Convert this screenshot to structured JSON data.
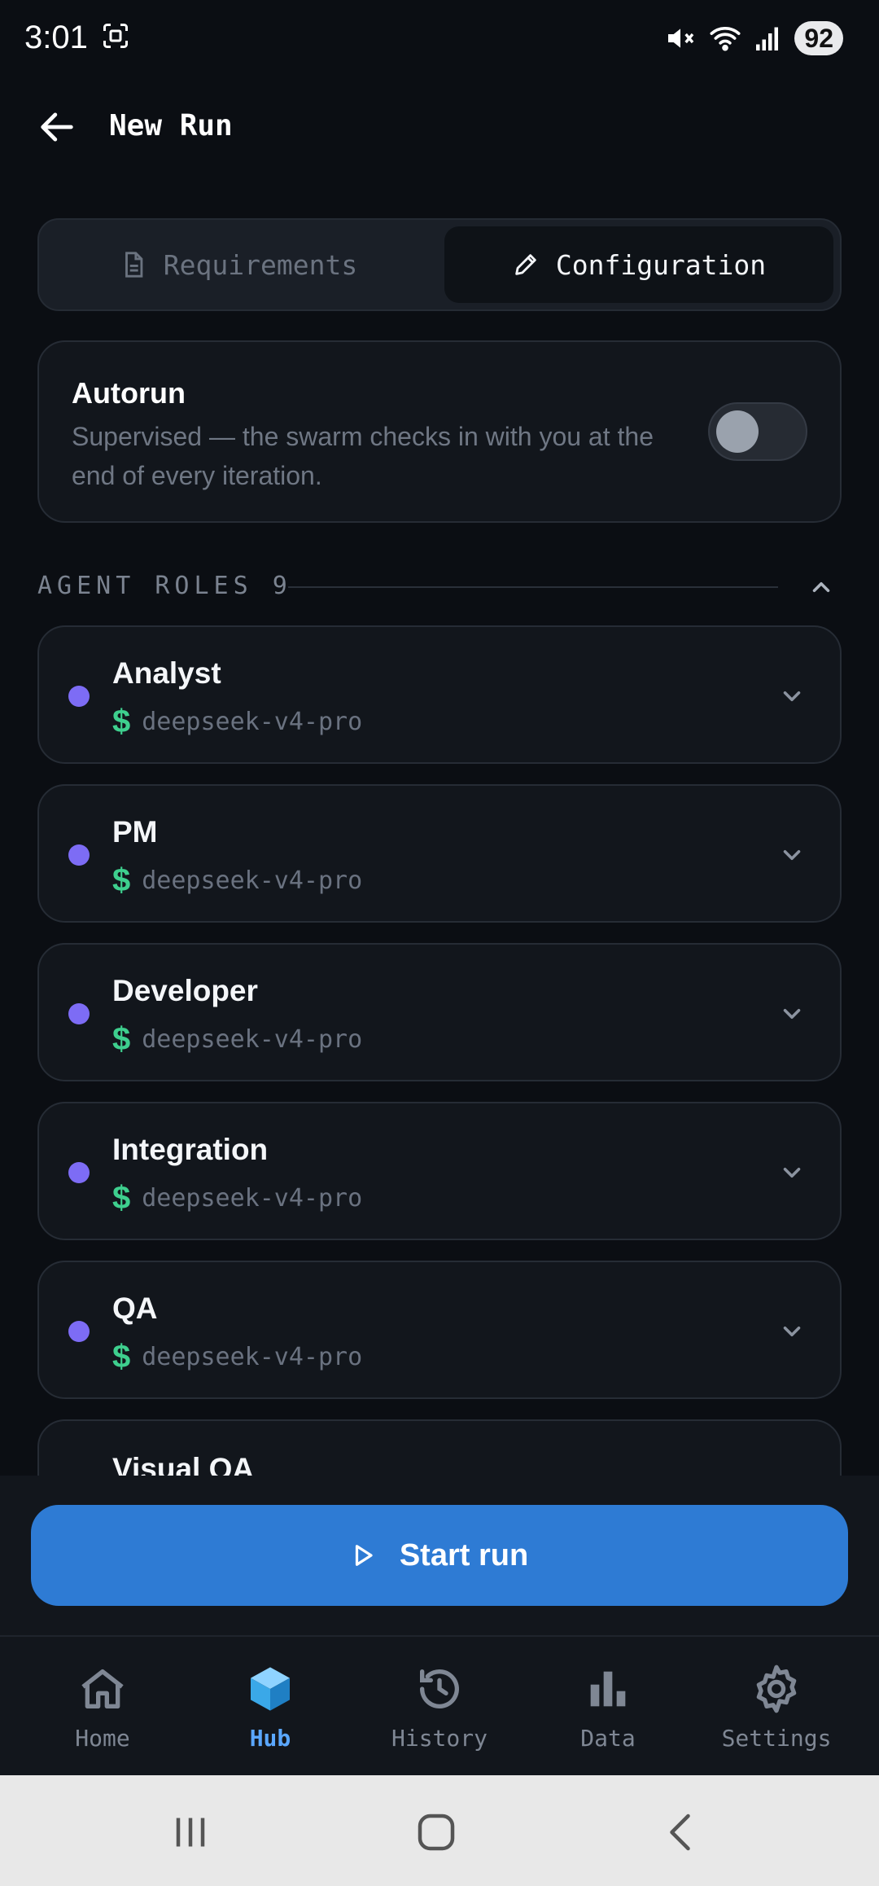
{
  "status_bar": {
    "time": "3:01",
    "battery": "92"
  },
  "app_bar": {
    "title": "New Run"
  },
  "tabs": [
    {
      "label": "Requirements",
      "active": false
    },
    {
      "label": "Configuration",
      "active": true
    }
  ],
  "autorun": {
    "title": "Autorun",
    "description": "Supervised — the swarm checks in with you at the end of every iteration.",
    "enabled": false
  },
  "agent_roles": {
    "label": "AGENT ROLES 9",
    "roles": [
      {
        "name": "Analyst",
        "currency": "$",
        "model": "deepseek-v4-pro"
      },
      {
        "name": "PM",
        "currency": "$",
        "model": "deepseek-v4-pro"
      },
      {
        "name": "Developer",
        "currency": "$",
        "model": "deepseek-v4-pro"
      },
      {
        "name": "Integration",
        "currency": "$",
        "model": "deepseek-v4-pro"
      },
      {
        "name": "QA",
        "currency": "$",
        "model": "deepseek-v4-pro"
      },
      {
        "name": "Visual QA"
      }
    ]
  },
  "start_button": {
    "label": "Start run"
  },
  "nav": [
    {
      "label": "Home",
      "icon": "home-icon",
      "active": false
    },
    {
      "label": "Hub",
      "icon": "cube-icon",
      "active": true
    },
    {
      "label": "History",
      "icon": "history-icon",
      "active": false
    },
    {
      "label": "Data",
      "icon": "bar-chart-icon",
      "active": false
    },
    {
      "label": "Settings",
      "icon": "gear-icon",
      "active": false
    }
  ],
  "colors": {
    "background": "#0b0e13",
    "card": "#12161c",
    "accent_blue": "#2e7bd4",
    "role_dot": "#7d6cf5",
    "cost_green": "#3ecf8e",
    "nav_active": "#5aa7ff"
  }
}
